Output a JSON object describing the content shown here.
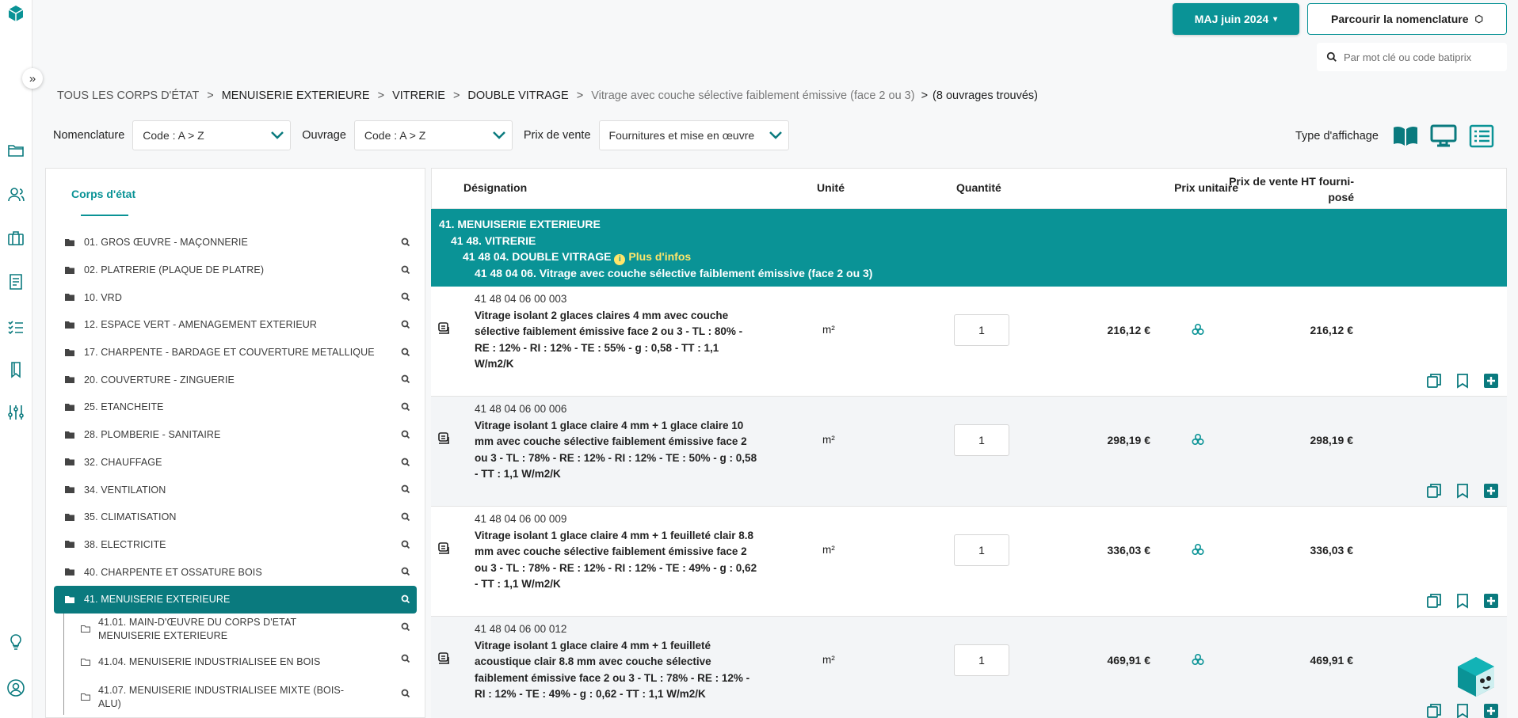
{
  "header": {
    "update_button": "MAJ juin 2024",
    "browse_button": "Parcourir la nomenclature",
    "search_placeholder": "Par mot clé ou code batiprix"
  },
  "breadcrumb": {
    "items": [
      "TOUS LES CORPS D'ÉTAT",
      "MENUISERIE EXTERIEURE",
      "VITRERIE",
      "DOUBLE VITRAGE",
      "Vitrage avec couche sélective faiblement émissive (face 2 ou 3)"
    ],
    "separator": ">",
    "count": "(8 ouvrages trouvés)"
  },
  "filters": {
    "nomenclature_label": "Nomenclature",
    "nomenclature_value": "Code : A > Z",
    "ouvrage_label": "Ouvrage",
    "ouvrage_value": "Code : A > Z",
    "prix_label": "Prix de vente",
    "prix_value": "Fournitures et mise en œuvre",
    "display_label": "Type d'affichage"
  },
  "left_panel": {
    "tab": "Corps d'état",
    "categories": [
      "01. GROS ŒUVRE - MAÇONNERIE",
      "02. PLATRERIE (PLAQUE DE PLATRE)",
      "10. VRD",
      "12. ESPACE VERT - AMENAGEMENT EXTERIEUR",
      "17. CHARPENTE - BARDAGE ET COUVERTURE METALLIQUE",
      "20. COUVERTURE - ZINGUERIE",
      "25. ETANCHEITE",
      "28. PLOMBERIE - SANITAIRE",
      "32. CHAUFFAGE",
      "34. VENTILATION",
      "35. CLIMATISATION",
      "38. ELECTRICITE",
      "40. CHARPENTE ET OSSATURE BOIS",
      "41. MENUISERIE EXTERIEURE"
    ],
    "subcategories": [
      "41.01. MAIN-D'ŒUVRE DU CORPS D'ETAT MENUISERIE EXTERIEURE",
      "41.04. MENUISERIE INDUSTRIALISEE EN BOIS",
      "41.07. MENUISERIE INDUSTRIALISEE MIXTE (BOIS-ALU)"
    ]
  },
  "table": {
    "columns": {
      "designation": "Désignation",
      "unit": "Unité",
      "quantity": "Quantité",
      "unit_price": "Prix unitaire",
      "sale_price": "Prix de vente HT fourni-posé"
    },
    "group": {
      "level1": "41. MENUISERIE EXTERIEURE",
      "level2": "41 48. VITRERIE",
      "level3": "41 48 04. DOUBLE VITRAGE",
      "more_info": "Plus d'infos",
      "level4": "41 48 04 06. Vitrage avec couche sélective faiblement émissive (face 2 ou 3)"
    },
    "rows": [
      {
        "code": "41 48 04 06 00 003",
        "description": "Vitrage isolant 2 glaces claires 4 mm avec couche sélective faiblement émissive face 2 ou 3 - TL : 80% - RE : 12% - RI : 12% - TE : 55% - g : 0,58 - TT : 1,1 W/m2/K",
        "unit": "m²",
        "quantity": "1",
        "unit_price": "216,12 €",
        "sale_price": "216,12 €"
      },
      {
        "code": "41 48 04 06 00 006",
        "description": "Vitrage isolant 1 glace claire 4 mm + 1 glace claire 10 mm avec couche sélective faiblement émissive face 2 ou 3 - TL : 78% - RE : 12% - RI : 12% - TE : 50% - g : 0,58 - TT : 1,1 W/m2/K",
        "unit": "m²",
        "quantity": "1",
        "unit_price": "298,19 €",
        "sale_price": "298,19 €"
      },
      {
        "code": "41 48 04 06 00 009",
        "description": "Vitrage isolant 1 glace claire 4 mm + 1 feuilleté clair 8.8 mm avec couche sélective faiblement émissive face 2 ou 3 - TL : 78% - RE : 12% - RI : 12% - TE : 49% - g : 0,62 - TT : 1,1 W/m2/K",
        "unit": "m²",
        "quantity": "1",
        "unit_price": "336,03 €",
        "sale_price": "336,03 €"
      },
      {
        "code": "41 48 04 06 00 012",
        "description": "Vitrage isolant 1 glace claire 4 mm + 1 feuilleté acoustique clair 8.8 mm avec couche sélective faiblement émissive face 2 ou 3 - TL : 78% - RE : 12% - RI : 12% - TE : 49% - g : 0,62 - TT : 1,1 W/m2/K",
        "unit": "m²",
        "quantity": "1",
        "unit_price": "469,91 €",
        "sale_price": "469,91 €"
      }
    ]
  },
  "colors": {
    "accent": "#0a9396",
    "accent_dark": "#0a7a7e",
    "info_yellow": "#ffe66a"
  }
}
